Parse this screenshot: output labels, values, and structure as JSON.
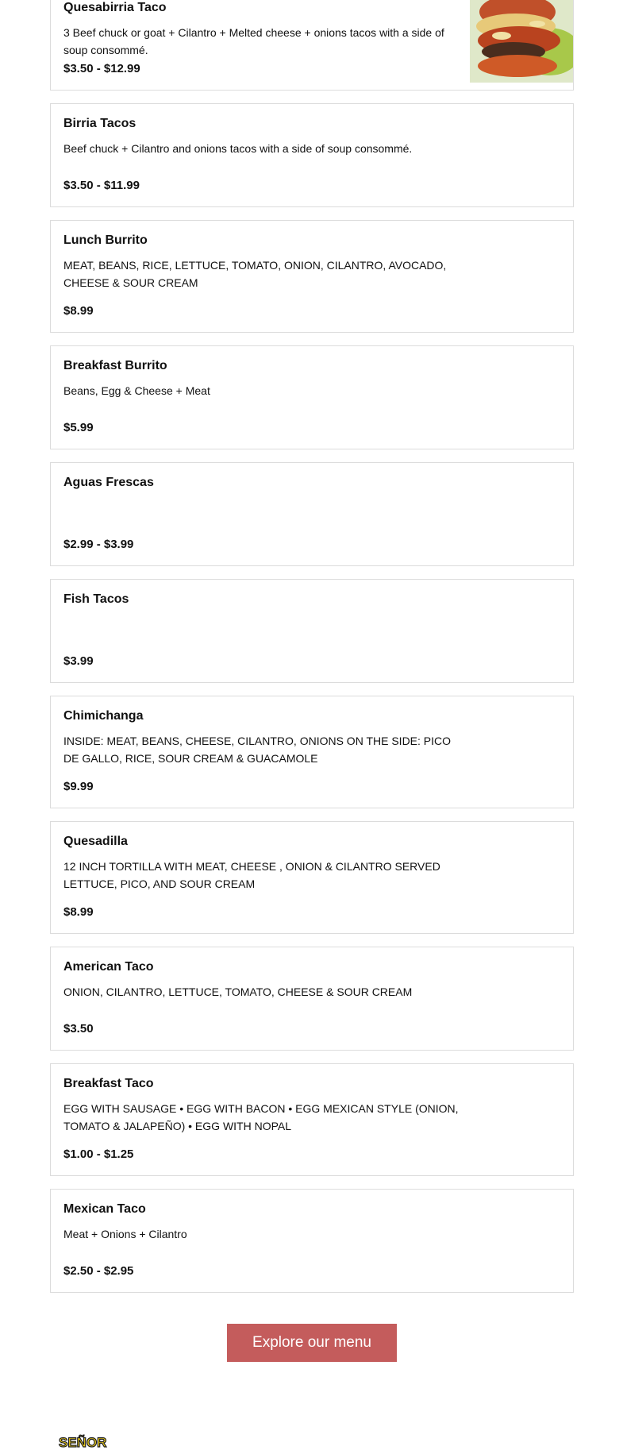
{
  "menu_items": [
    {
      "name": "Quesabirria Taco",
      "description": "3 Beef chuck or goat + Cilantro + Melted cheese + onions tacos with a side of soup consommé.",
      "price": "$3.50 - $12.99"
    },
    {
      "name": "Birria Tacos",
      "description": "Beef chuck + Cilantro and onions tacos with a side of soup consommé.",
      "price": "$3.50 - $11.99"
    },
    {
      "name": "Lunch Burrito",
      "description": "MEAT, BEANS, RICE, LETTUCE, TOMATO, ONION, CILANTRO, AVOCADO, CHEESE & SOUR CREAM",
      "price": "$8.99"
    },
    {
      "name": "Breakfast Burrito",
      "description": "Beans, Egg & Cheese + Meat",
      "price": "$5.99"
    },
    {
      "name": "Aguas Frescas",
      "description": "",
      "price": "$2.99 - $3.99"
    },
    {
      "name": "Fish Tacos",
      "description": "",
      "price": "$3.99"
    },
    {
      "name": "Chimichanga",
      "description": "INSIDE: MEAT, BEANS, CHEESE, CILANTRO, ONIONS ON THE SIDE: PICO DE GALLO, RICE, SOUR CREAM & GUACAMOLE",
      "price": "$9.99"
    },
    {
      "name": "Quesadilla",
      "description": "12 INCH TORTILLA WITH MEAT, CHEESE , ONION & CILANTRO SERVED LETTUCE, PICO, AND SOUR CREAM",
      "price": "$8.99"
    },
    {
      "name": "American Taco",
      "description": "ONION, CILANTRO, LETTUCE, TOMATO, CHEESE & SOUR CREAM",
      "price": "$3.50"
    },
    {
      "name": "Breakfast Taco",
      "description": "EGG WITH SAUSAGE • EGG WITH BACON • EGG MEXICAN STYLE (ONION, TOMATO & JALAPEÑO) • EGG WITH NOPAL",
      "price": "$1.00 - $1.25"
    },
    {
      "name": "Mexican Taco",
      "description": "Meat + Onions + Cilantro",
      "price": "$2.50 - $2.95"
    }
  ],
  "explore_button": {
    "label": "Explore our menu"
  },
  "footer": {
    "logo_text": "SEÑOR"
  },
  "colors": {
    "button": "#c45c5c",
    "card_border": "#dcdcdc",
    "logo_yellow": "#f2d21b"
  }
}
